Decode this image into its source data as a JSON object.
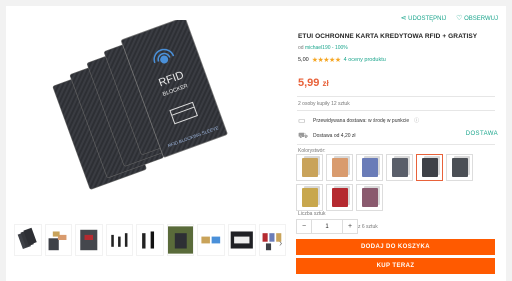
{
  "share": {
    "share_label": "UDOSTĘPNIJ",
    "watch_label": "OBSERWUJ"
  },
  "product": {
    "title": "ETUI OCHRONNE KARTA KREDYTOWA RFID + GRATISY",
    "seller_prefix": "od",
    "seller": "michael190 - 100%",
    "rating_value": "5,00",
    "stars": "★★★★★",
    "reviews": "4 oceny produktu",
    "price_main": "5,99",
    "price_currency": "zł",
    "buyers": "2 osoby kupiły 12 sztuk",
    "free_shipping": "Przewidywana dostawa: w środę w punkcie",
    "delivery_cost": "Dostawa od 4,20 zł",
    "delivery_link": "DOSTAWA",
    "card_text": "RFID",
    "card_sub": "BLOCKER",
    "card_side": "RFID BLOCKING SLEEVE"
  },
  "variants": {
    "label": "Kolorystwór:",
    "colors": [
      "#c9a35a",
      "#d99b6e",
      "#6a7cb8",
      "#5a5f6a",
      "#3e4147",
      "#4b4f55",
      "#c8a74d",
      "#b52a30",
      "#8a5a6e"
    ],
    "selected_index": 4
  },
  "quantity": {
    "label": "Liczba sztuk",
    "value": "1",
    "minus": "−",
    "plus": "+",
    "of_total": "z 6 sztuk"
  },
  "actions": {
    "add_to_cart": "DODAJ DO KOSZYKA",
    "buy_now": "KUP TERAZ"
  },
  "icons": {
    "share": "share-icon",
    "heart": "heart-icon",
    "truck": "truck-icon",
    "info": "info-icon",
    "package": "package-icon"
  }
}
